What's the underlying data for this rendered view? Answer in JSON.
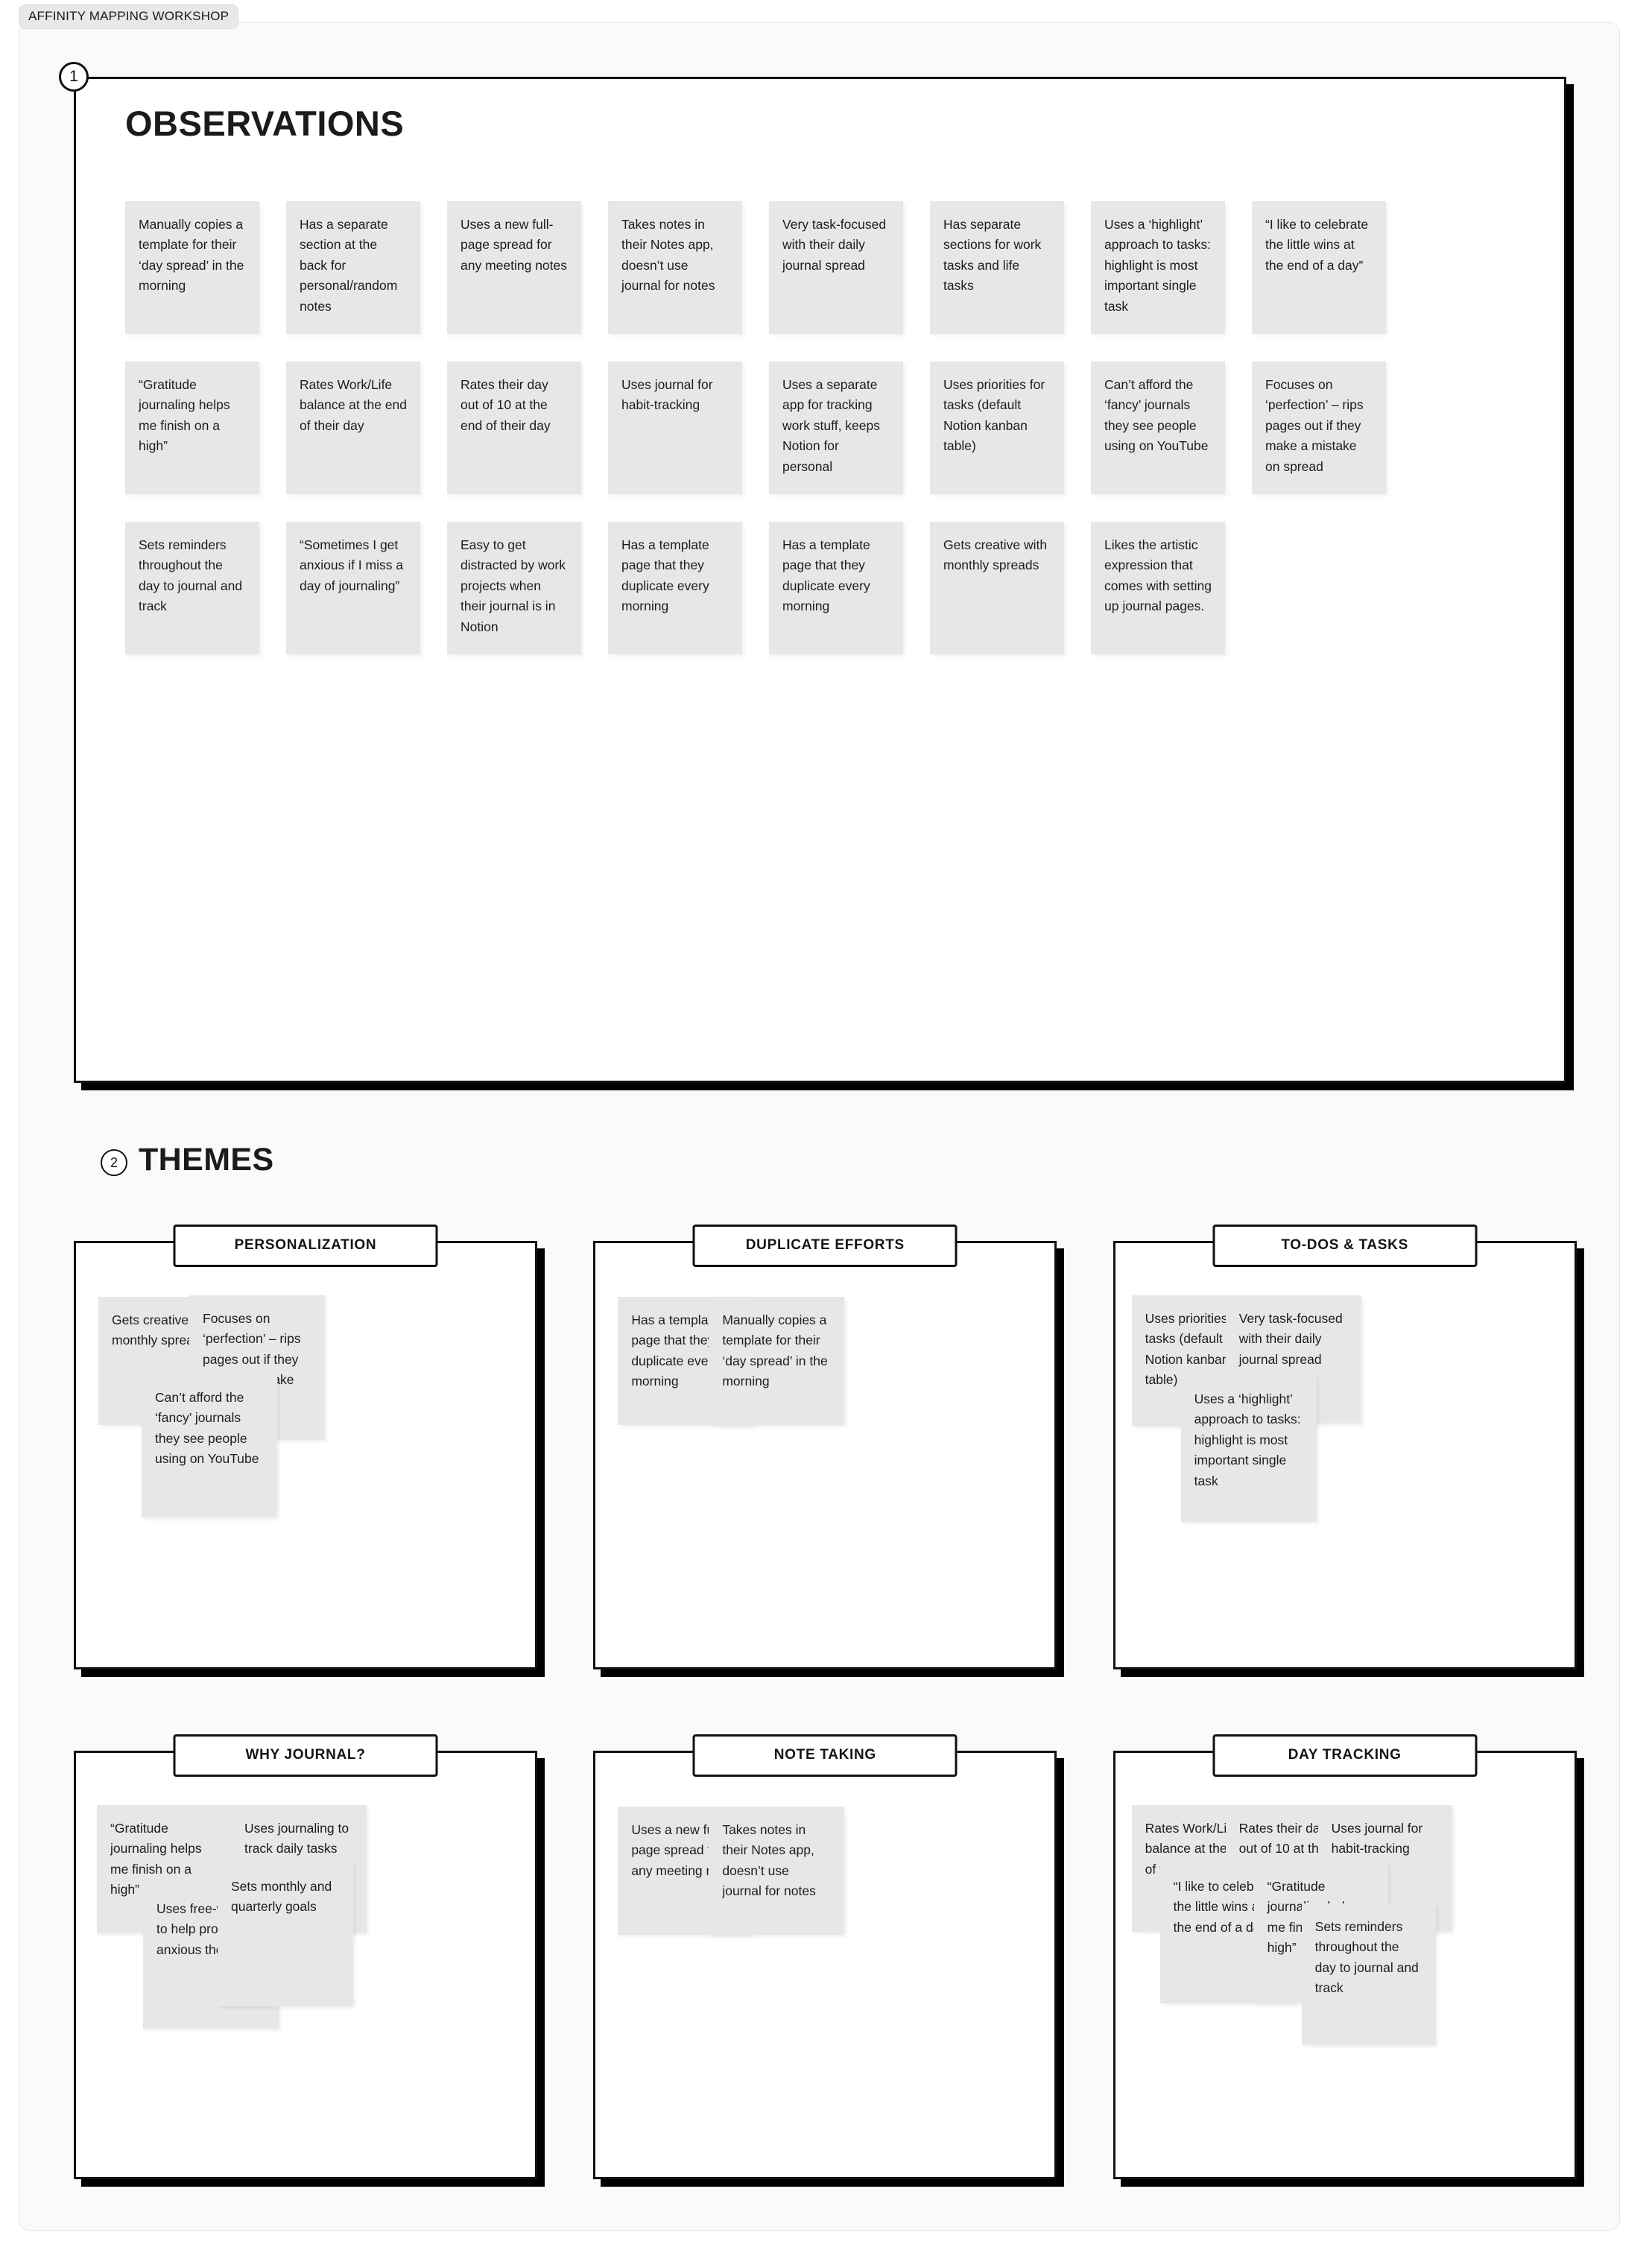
{
  "workshop_badge": "AFFINITY MAPPING WORKSHOP",
  "sections": {
    "observations": {
      "marker": "1",
      "title": "OBSERVATIONS",
      "notes": [
        "Manually copies a template for their ‘day spread’ in the morning",
        "Has a separate section at the back for personal/random notes",
        "Uses a new full-page spread for any meeting notes",
        "Takes notes in their Notes app, doesn’t use journal for notes",
        "Very task-focused with their daily journal spread",
        "Has separate sections for work tasks and life tasks",
        "Uses a ‘highlight’ approach to tasks: highlight is most important single task",
        "“I like to celebrate the little wins at the end of a day”",
        "“Gratitude journaling helps me finish on a high”",
        "Rates Work/Life balance at the end of their day",
        "Rates their day out of 10 at the end of their day",
        "Uses journal for habit-tracking",
        "Uses a separate app for tracking work stuff, keeps Notion for personal",
        "Uses priorities for tasks (default Notion kanban table)",
        "Can’t afford the ‘fancy’ journals they see people using on YouTube",
        "Focuses on ‘perfection’ – rips pages out if they make a mistake on spread",
        "Sets reminders throughout the day to journal and track",
        "“Sometimes I get anxious if I miss a day of journaling”",
        "Easy to get distracted by work projects when their journal is in Notion",
        "Has a template page that they duplicate every morning",
        "Has a template page that they duplicate every morning",
        "Gets creative with monthly spreads",
        "Likes the artistic expression that comes with setting up journal pages."
      ]
    },
    "themes": {
      "marker": "2",
      "title": "THEMES",
      "cards": [
        {
          "title": "PERSONALIZATION",
          "notes": [
            "Gets creative with monthly spreads",
            "Focuses on ‘perfection’ – rips pages out if they make a mistake on spread",
            "Can’t afford the ‘fancy’ journals they see people using on YouTube"
          ]
        },
        {
          "title": "DUPLICATE EFFORTS",
          "notes": [
            "Has a template page that they duplicate every morning",
            "Manually copies a template for their ‘day spread’ in the morning"
          ]
        },
        {
          "title": "TO-DOS & TASKS",
          "notes": [
            "Uses priorities for tasks (default Notion kanban table)",
            "Very task-focused with their daily journal spread",
            "Uses a ‘highlight’ approach to tasks: highlight is most important single task"
          ]
        },
        {
          "title": "WHY JOURNAL?",
          "notes": [
            "“Gratitude journaling helps me finish on a high”",
            "Uses journaling to track daily tasks",
            "Uses free-writing to help process anxious thoughts",
            "Sets monthly and quarterly goals"
          ]
        },
        {
          "title": "NOTE TAKING",
          "notes": [
            "Uses a new full-page spread for any meeting notes",
            "Takes notes in their Notes app, doesn’t use journal for notes"
          ]
        },
        {
          "title": "DAY TRACKING",
          "notes": [
            "Rates Work/Life balance at the end of their day",
            "Rates their day out of 10 at the end of their day",
            "Uses journal for habit-tracking",
            "“I like to celebrate the little wins at the end of a day”",
            "“Gratitude journaling helps me finish on a high”",
            "Sets reminders throughout the day to journal and track"
          ]
        }
      ]
    }
  },
  "colors": {
    "note_bg": "#e7e7e7",
    "card_border": "#111111",
    "canvas_bg": "#fafafa",
    "badge_bg": "#e8e8e8"
  }
}
